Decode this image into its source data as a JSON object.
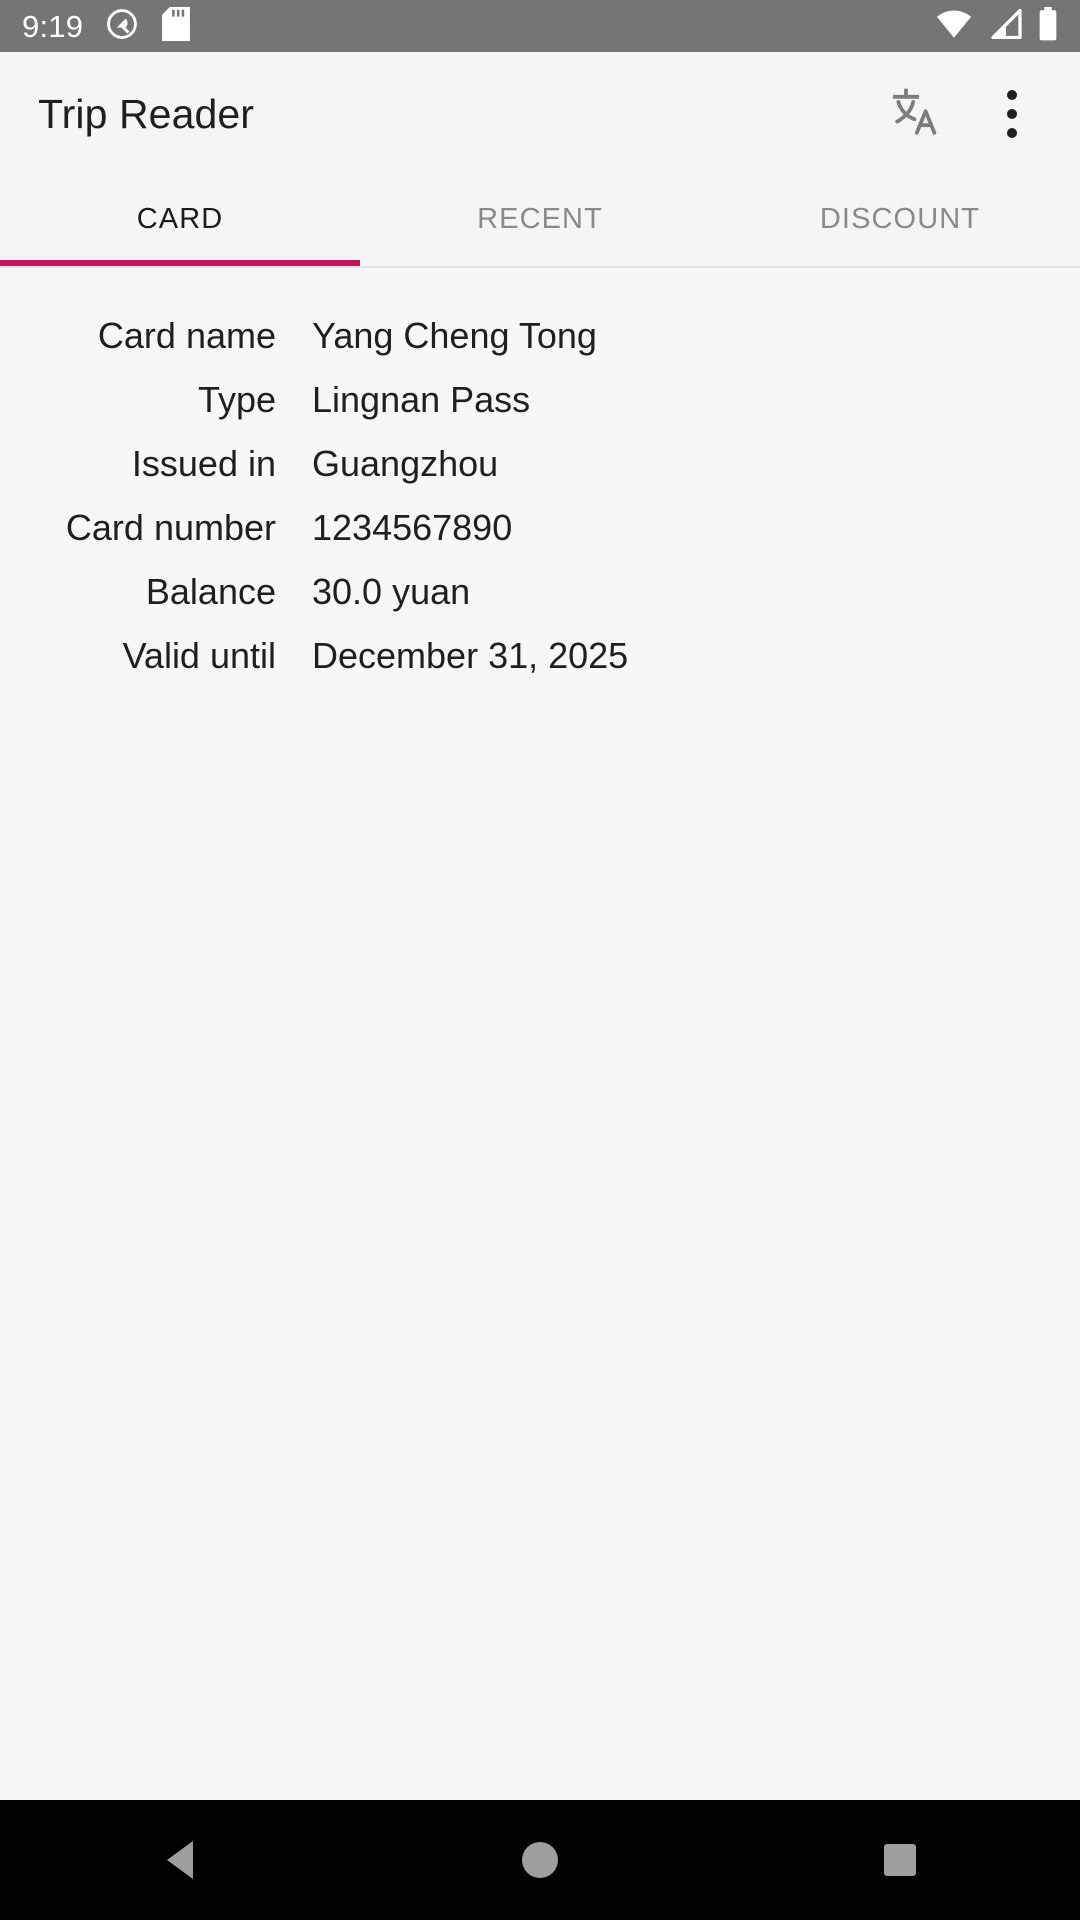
{
  "status_bar": {
    "time": "9:19",
    "icons": [
      "android-q-icon",
      "sd-card-icon",
      "wifi-icon",
      "cellular-signal-icon",
      "battery-icon"
    ],
    "background_color": "#757575"
  },
  "app_bar": {
    "title": "Trip Reader",
    "translate_action_label": "Translate",
    "overflow_action_label": "More options"
  },
  "tabs": {
    "items": [
      {
        "label": "CARD",
        "active": true
      },
      {
        "label": "RECENT",
        "active": false
      },
      {
        "label": "DISCOUNT",
        "active": false
      }
    ],
    "indicator_color": "#c2185b"
  },
  "card_details": {
    "rows": [
      {
        "label": "Card name",
        "value": "Yang Cheng Tong"
      },
      {
        "label": "Type",
        "value": "Lingnan Pass"
      },
      {
        "label": "Issued in",
        "value": "Guangzhou"
      },
      {
        "label": "Card number",
        "value": "1234567890"
      },
      {
        "label": "Balance",
        "value": "30.0 yuan"
      },
      {
        "label": "Valid until",
        "value": "December 31, 2025"
      }
    ]
  },
  "nav_bar": {
    "back_label": "Back",
    "home_label": "Home",
    "recents_label": "Recents"
  }
}
